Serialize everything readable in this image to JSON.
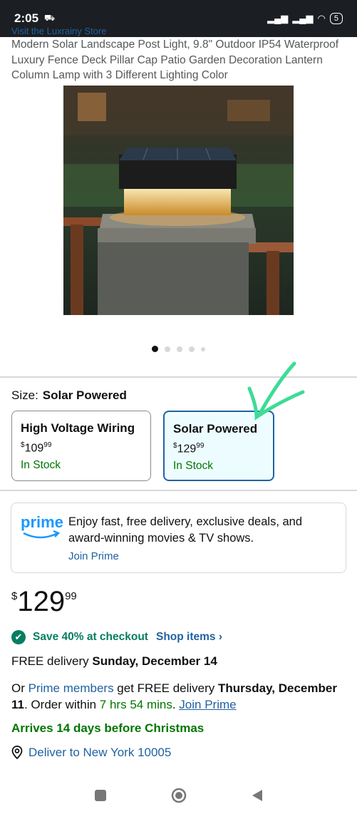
{
  "status": {
    "time": "2:05",
    "battery": "5"
  },
  "product": {
    "store_link": "Visit the Luxrainy Store",
    "title": "Modern Solar Landscape Post Light, 9.8\" Outdoor IP54 Waterproof Luxury Fence Deck Pillar Cap Patio Garden Decoration Lantern Column Lamp with 3 Different Lighting Color",
    "image_count": 5,
    "active_image": 1
  },
  "size": {
    "label": "Size:",
    "selected": "Solar Powered",
    "options": [
      {
        "name": "High Voltage Wiring",
        "currency": "$",
        "price_whole": "109",
        "price_cents": "99",
        "stock": "In Stock",
        "selected": false
      },
      {
        "name": "Solar Powered",
        "currency": "$",
        "price_whole": "129",
        "price_cents": "99",
        "stock": "In Stock",
        "selected": true
      }
    ]
  },
  "prime": {
    "logo": "prime",
    "text": "Enjoy fast, free delivery, exclusive deals, and award-winning movies & TV shows.",
    "join": "Join Prime"
  },
  "price": {
    "currency": "$",
    "whole": "129",
    "cents": "99"
  },
  "savings": {
    "text": "Save 40% at checkout",
    "link": "Shop items ›"
  },
  "delivery": {
    "free_prefix": "FREE delivery ",
    "free_date": "Sunday, December 14",
    "or": "Or ",
    "prime_members": "Prime members",
    "get_free": " get FREE delivery ",
    "prime_date": "Thursday, December 11",
    "order_within": ". Order within ",
    "time_left": "7 hrs 54 mins",
    "join_prime": "Join Prime"
  },
  "arrives": "Arrives 14 days before Christmas",
  "deliver_to": "Deliver to New York 10005",
  "colors": {
    "link": "#2162a1",
    "green": "#007600",
    "selected_border": "#2162a1",
    "prime_blue": "#1a98ff",
    "annotation": "#3ddc97"
  }
}
